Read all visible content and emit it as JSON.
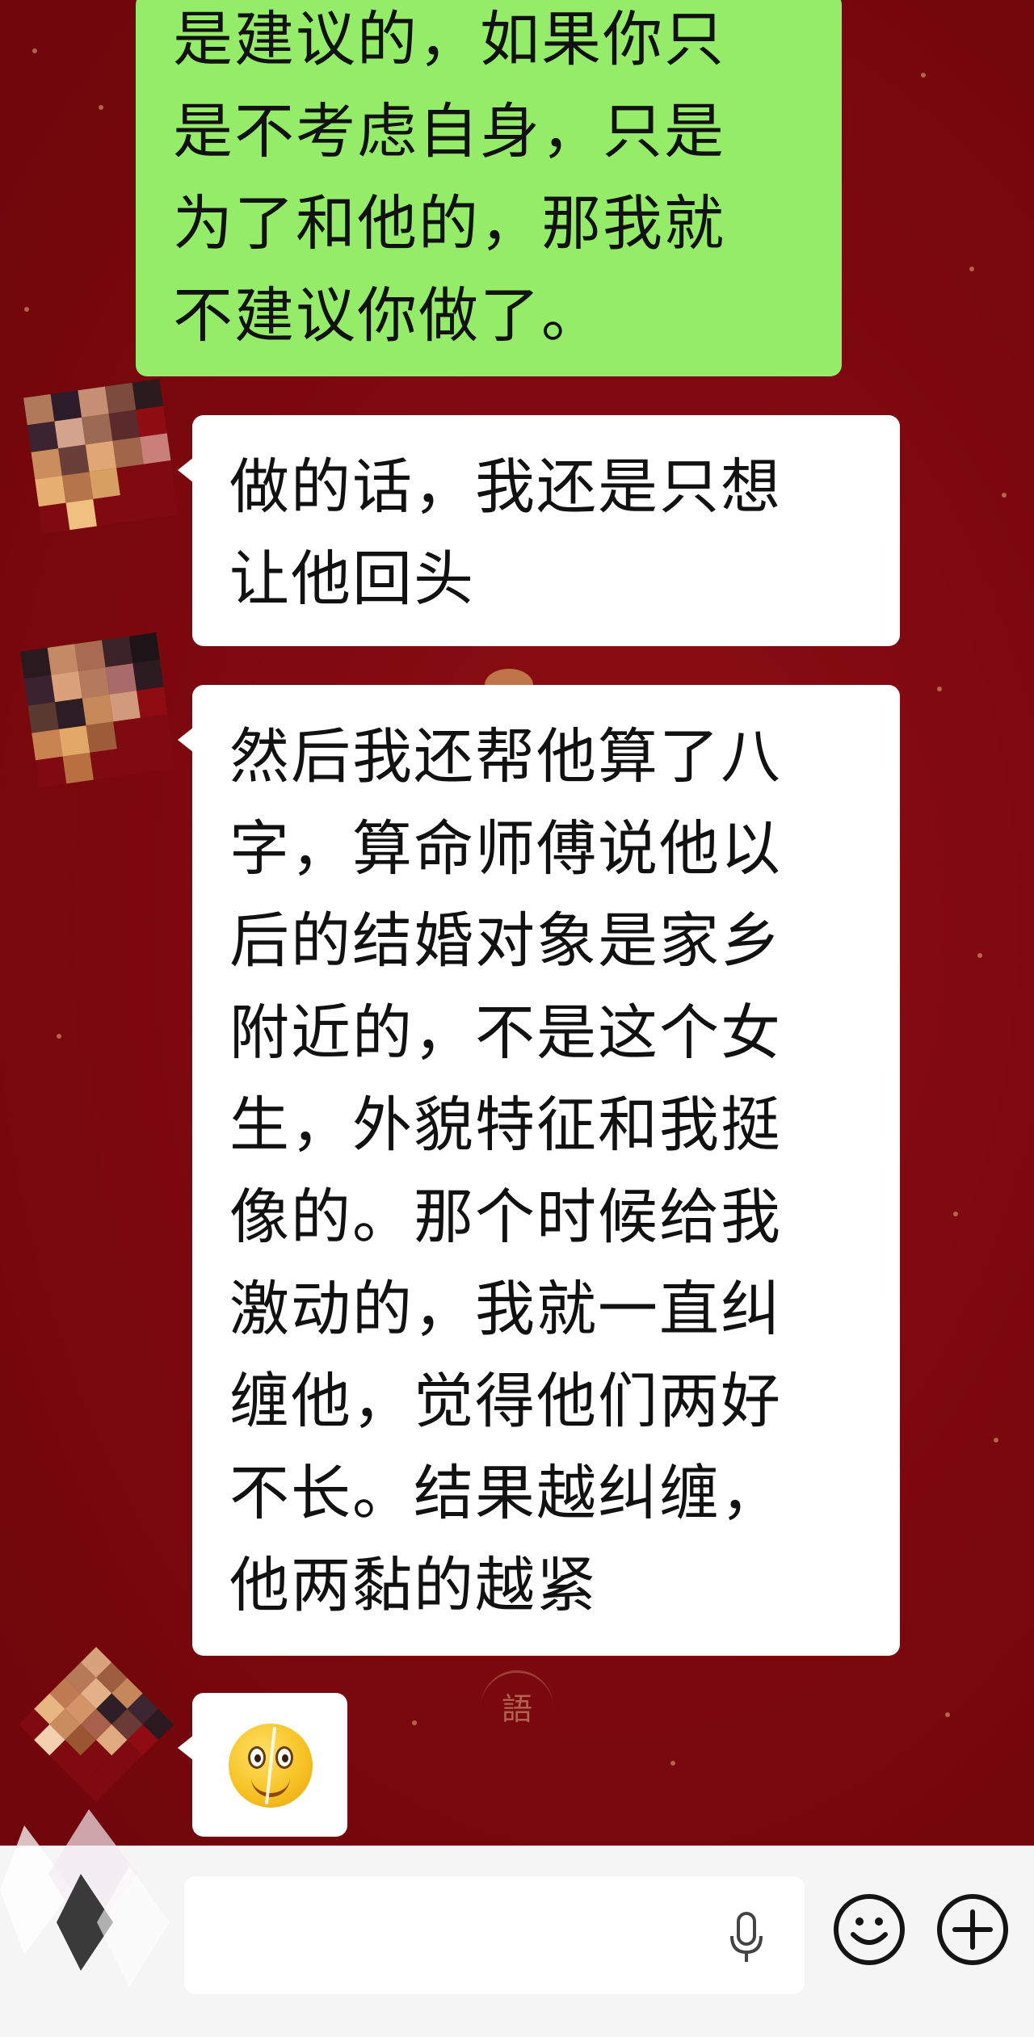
{
  "messages": [
    {
      "side": "right",
      "type": "text",
      "text": "是建议的，如果你只\n是不考虑自身，只是\n为了和他的，那我就\n不建议你做了。"
    },
    {
      "side": "left",
      "type": "text",
      "text": "做的话，我还是只想\n让他回头"
    },
    {
      "side": "left",
      "type": "text",
      "text": "然后我还帮他算了八\n字，算命师傅说他以\n后的结婚对象是家乡\n附近的，不是这个女\n生，外貌特征和我挺\n像的。那个时候给我\n激动的，我就一直纠\n缠他，觉得他们两好\n不长。结果越纠缠，\n他两黏的越紧"
    },
    {
      "side": "left",
      "type": "emoji",
      "emoji": "cracked-smile-emoji"
    }
  ],
  "background": {
    "theme": "red-festive",
    "color": "#7e0a0e",
    "watermark": "語"
  },
  "input_bar": {
    "placeholder": "",
    "voice_icon": "microphone-icon",
    "emoji_button_icon": "smile-icon",
    "more_button_icon": "plus-icon"
  },
  "colors": {
    "sent_bubble": "#95ec69",
    "received_bubble": "#ffffff",
    "input_bar": "#f5f5f5"
  }
}
